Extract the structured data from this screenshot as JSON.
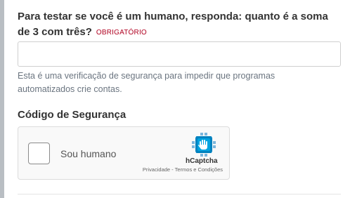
{
  "form": {
    "question": "Para testar se você é um humano, responda: quanto é a soma de 3 com três?",
    "required_label": "OBRIGATÓRIO",
    "answer_value": "",
    "help_text": "Esta é uma verificação de segurança para impedir que programas automatizados crie contas.",
    "security_title": "Código de Segurança"
  },
  "captcha": {
    "checkbox_label": "Sou humano",
    "brand": "hCaptcha",
    "privacy_link": "Privacidade",
    "separator": " - ",
    "terms_link": "Termos e Condições",
    "logo_icon": "hcaptcha-hand-icon",
    "brand_color": "#00838f"
  }
}
